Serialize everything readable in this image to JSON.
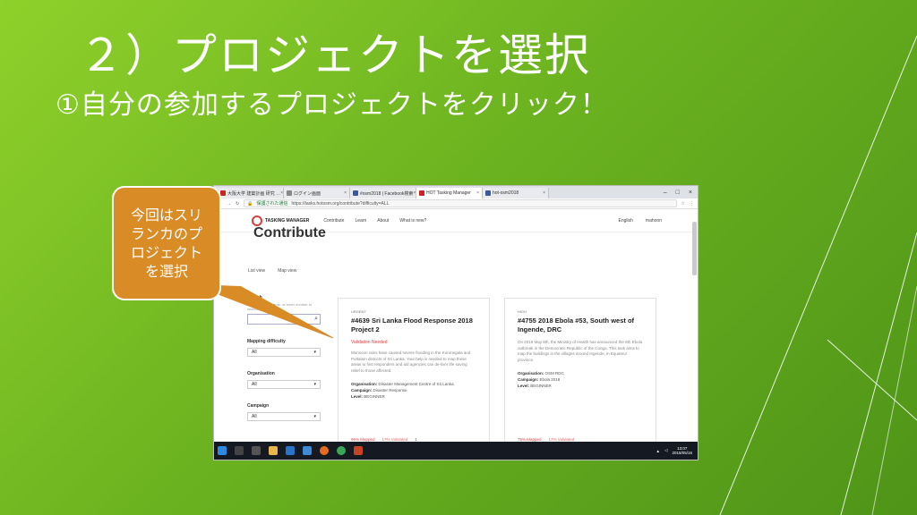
{
  "slide": {
    "title": "２）プロジェクトを選択",
    "subtitle": "①自分の参加するプロジェクトをクリック！",
    "callout": "今回はスリ\nランカのプ\nロジェクト\nを選択",
    "colors": {
      "background": "#6cb320",
      "callout": "#d98b26",
      "text": "#ffffff"
    }
  },
  "browser": {
    "tabs": [
      {
        "label": "大阪大学 建築計画 研究 …",
        "active": false
      },
      {
        "label": "ログイン画面",
        "active": false
      },
      {
        "label": "#osm2018 | Facebook検索",
        "active": false
      },
      {
        "label": "HOT Tasking Manager",
        "active": true
      },
      {
        "label": "hot-osm2018",
        "active": false
      }
    ],
    "secure_label": "保護された通信",
    "url": "https://tasks.hotosm.org/contribute?difficulty=ALL",
    "window_controls": [
      "–",
      "□",
      "×"
    ]
  },
  "site": {
    "logo_text": "TASKING MANAGER",
    "nav": [
      "Contribute",
      "Learn",
      "About",
      "What is new?"
    ],
    "language": "English",
    "username": "mahoon",
    "page_heading": "Contribute",
    "view_tabs": [
      "List view",
      "Map view"
    ]
  },
  "sidebar": {
    "search_label": "Search",
    "search_hint": "Search project name, or enter number to search project",
    "difficulty_label": "Mapping difficulty",
    "difficulty_value": "All",
    "org_label": "Organisation",
    "org_value": "All",
    "campaign_label": "Campaign",
    "campaign_value": "All"
  },
  "projects": [
    {
      "org_tag": "URGENT",
      "title": "#4639 Sri Lanka Flood Response 2018 Project 2",
      "priority": "Validation Needed",
      "description": "Monsoon rains have caused severe flooding in the Kurunegala and Puttalam districts of Sri Lanka. Your help is needed to map these areas to first responders and aid agencies can de-liver life saving relief to those affected.",
      "organisation": "Disaster Management Centre of Sri Lanka",
      "campaign": "Disaster Response",
      "level": "BEGINNER",
      "mapped": "96% Mapped",
      "validated": "17% Validated",
      "contributors": "1"
    },
    {
      "org_tag": "HIGH",
      "title": "#4755 2018 Ebola #53, South west of Ingende, DRC",
      "priority": "",
      "description": "On 2018 May 8th, the Ministry of Health has announced the 9th Ebola outbreak in the Democratic Republic of the Congo. This task aims to map the buildings in the villages around Ingende, in Equateur province.",
      "organisation": "OSM RDC",
      "campaign": "Ebola 2018",
      "level": "BEGINNER",
      "mapped": "75% Mapped",
      "validated": "17% Validated",
      "contributors": ""
    }
  ],
  "taskbar": {
    "time": "13:07",
    "date": "2018/05/16",
    "icons": [
      "windows-icon",
      "search-icon",
      "task-view-icon",
      "explorer-icon",
      "edge-icon",
      "store-icon",
      "firefox-icon",
      "chrome-icon",
      "powerpoint-icon"
    ]
  }
}
